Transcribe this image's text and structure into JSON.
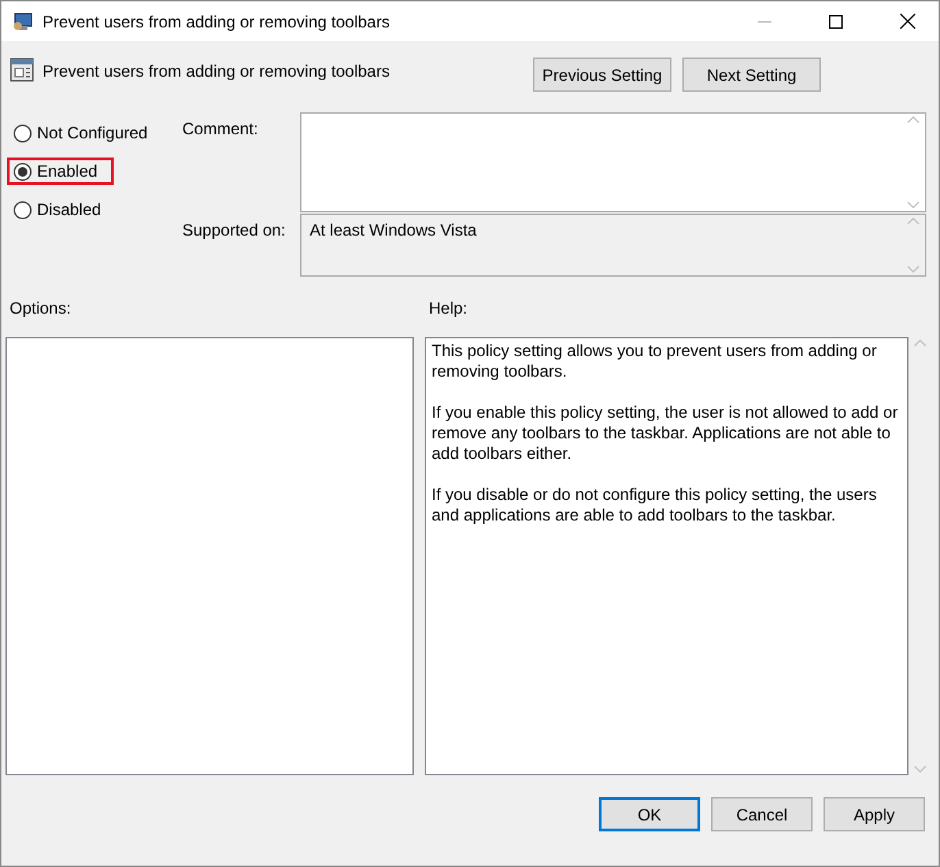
{
  "window": {
    "title": "Prevent users from adding or removing toolbars"
  },
  "setting_title": "Prevent users from adding or removing toolbars",
  "nav_buttons": [
    "Previous Setting",
    "Next Setting"
  ],
  "options": [
    {
      "label": "Not Configured",
      "selected": false,
      "highlighted": false
    },
    {
      "label": "Enabled",
      "selected": true,
      "highlighted": true
    },
    {
      "label": "Disabled",
      "selected": false,
      "highlighted": false
    }
  ],
  "comment": {
    "label": "Comment:"
  },
  "supported_on": {
    "label": "Supported on:",
    "value": "At least Windows Vista"
  },
  "options_label": "Options:",
  "help": {
    "label": "Help:",
    "paragraphs": [
      "This policy setting allows you to prevent users from adding or removing toolbars.",
      "If you enable this policy setting, the user is not allowed to add or remove any toolbars to the taskbar. Applications are not able to add toolbars either.",
      "If you disable or do not configure this policy setting, the users and applications are able to add toolbars to the taskbar."
    ]
  },
  "buttons": [
    {
      "label": "OK",
      "default": true
    },
    {
      "label": "Cancel",
      "default": false
    },
    {
      "label": "Apply",
      "default": false
    }
  ]
}
